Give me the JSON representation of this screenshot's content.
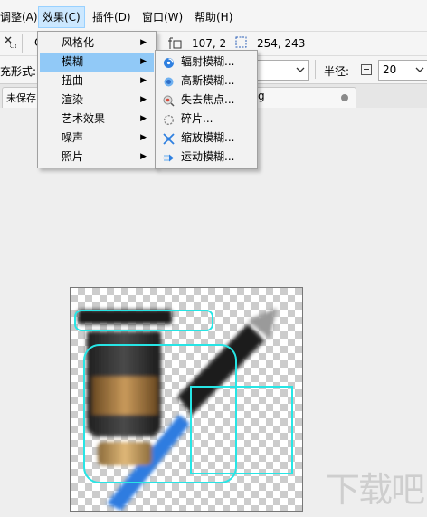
{
  "menubar": {
    "items": [
      "调整(A)",
      "效果(C)",
      "插件(D)",
      "窗口(W)",
      "帮助(H)"
    ]
  },
  "toolbar1": {
    "size_readout": "107, 2",
    "position_readout": "254, 243",
    "left_glyph": "O"
  },
  "toolbar2": {
    "fill_mode_label": "充形式:",
    "radius_label": "半径:",
    "radius_value": "20"
  },
  "tabs": {
    "tab1_label": "未保存",
    "tab2_fragment": "g"
  },
  "effects_menu": {
    "items": [
      {
        "label": "风格化",
        "has_submenu": true
      },
      {
        "label": "模糊",
        "has_submenu": true
      },
      {
        "label": "扭曲",
        "has_submenu": true
      },
      {
        "label": "渲染",
        "has_submenu": true
      },
      {
        "label": "艺术效果",
        "has_submenu": true
      },
      {
        "label": "噪声",
        "has_submenu": true
      },
      {
        "label": "照片",
        "has_submenu": true
      }
    ],
    "highlighted_index": 1
  },
  "blur_submenu": {
    "items": [
      {
        "label": "辐射模糊...",
        "icon": "radial-blur-icon"
      },
      {
        "label": "高斯模糊...",
        "icon": "gaussian-blur-icon"
      },
      {
        "label": "失去焦点...",
        "icon": "unfocus-icon"
      },
      {
        "label": "碎片...",
        "icon": "fragment-icon"
      },
      {
        "label": "缩放模糊...",
        "icon": "zoom-blur-icon"
      },
      {
        "label": "运动模糊...",
        "icon": "motion-blur-icon"
      }
    ]
  },
  "watermark": "下载吧",
  "colors": {
    "highlight": "#91c9f7",
    "active_menu": "#cce8ff",
    "selection": "#27e5e5"
  }
}
